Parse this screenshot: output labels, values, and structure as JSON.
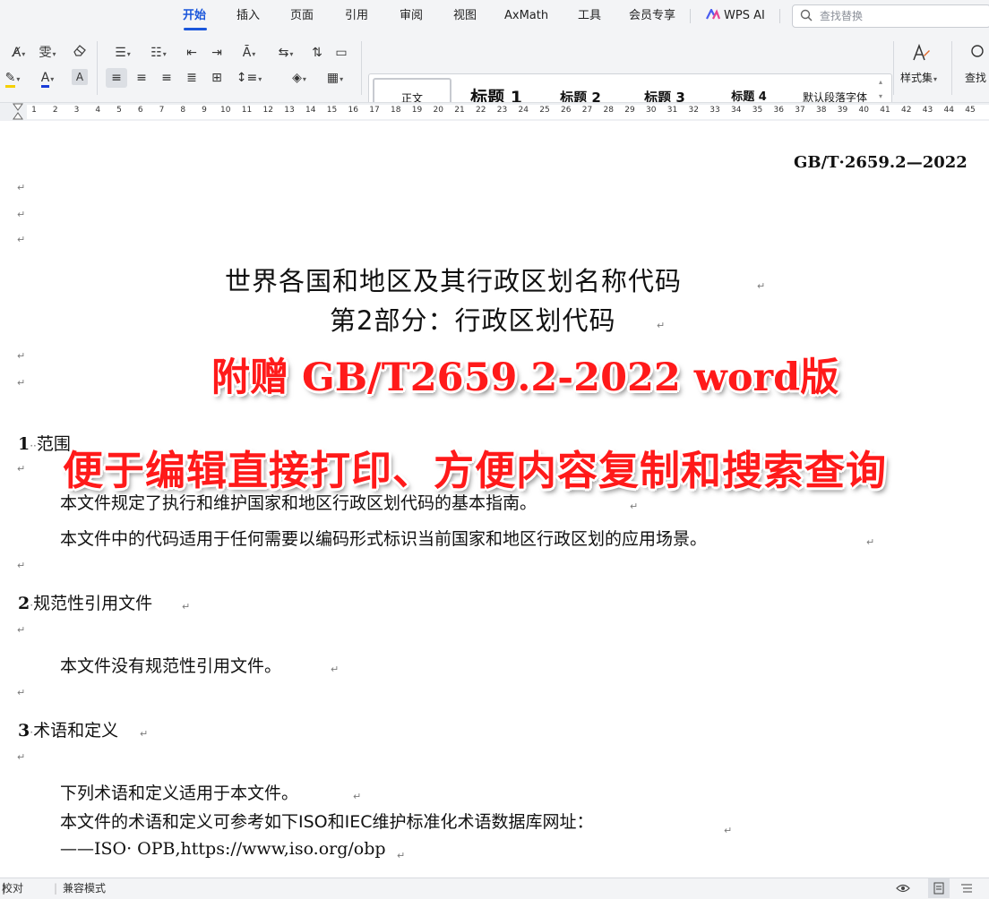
{
  "menubar": {
    "tabs": [
      {
        "label": "开始",
        "active": true
      },
      {
        "label": "插入"
      },
      {
        "label": "页面"
      },
      {
        "label": "引用"
      },
      {
        "label": "审阅"
      },
      {
        "label": "视图"
      },
      {
        "label": "AxMath"
      },
      {
        "label": "工具"
      },
      {
        "label": "会员专享"
      }
    ],
    "wps_ai": "WPS AI",
    "search_placeholder": "查找替换",
    "accent_color": "#1a56db"
  },
  "ribbon": {
    "styles": [
      "正文",
      "标题 1",
      "标题 2",
      "标题 3",
      "标题 4",
      "默认段落字体"
    ],
    "style_set_label": "样式集",
    "find_label": "查找"
  },
  "ruler": {
    "numbers": [
      "1",
      "2",
      "3",
      "4",
      "5",
      "6",
      "7",
      "8",
      "9",
      "10",
      "11",
      "12",
      "13",
      "14",
      "15",
      "16",
      "17",
      "18",
      "19",
      "20",
      "21",
      "22",
      "23",
      "24",
      "25",
      "26",
      "27",
      "28",
      "29",
      "30",
      "31",
      "32",
      "33",
      "34",
      "35",
      "36",
      "37",
      "38",
      "39",
      "40",
      "41",
      "42",
      "43",
      "44",
      "45"
    ]
  },
  "document": {
    "standard_number": "GB/T·2659.2—2022",
    "title_line1": "世界各国和地区及其行政区划名称代码",
    "title_line2": "第2部分：行政区划代码",
    "promo_line1": "附赠 GB/T2659.2-2022 word版",
    "promo_line2": "便于编辑直接打印、方便内容复制和搜索查询",
    "sections": [
      {
        "num": "1",
        "title": "范围"
      },
      {
        "num": "2",
        "title": "规范性引用文件"
      },
      {
        "num": "3",
        "title": "术语和定义"
      }
    ],
    "scope_p1": "本文件规定了执行和维护国家和地区行政区划代码的基本指南。",
    "scope_p2": "本文件中的代码适用于任何需要以编码形式标识当前国家和地区行政区划的应用场景。",
    "norm_p1": "本文件没有规范性引用文件。",
    "terms_p1": "下列术语和定义适用于本文件。",
    "terms_p2": "本文件的术语和定义可参考如下ISO和IEC维护标准化术语数据库网址：",
    "terms_p3": "——ISO· OPB,https://www,iso.org/obp",
    "para_mark": "↵",
    "promo_color": "#ff1a1a"
  },
  "statusbar": {
    "proofread": "校对",
    "mode": "兼容模式"
  }
}
